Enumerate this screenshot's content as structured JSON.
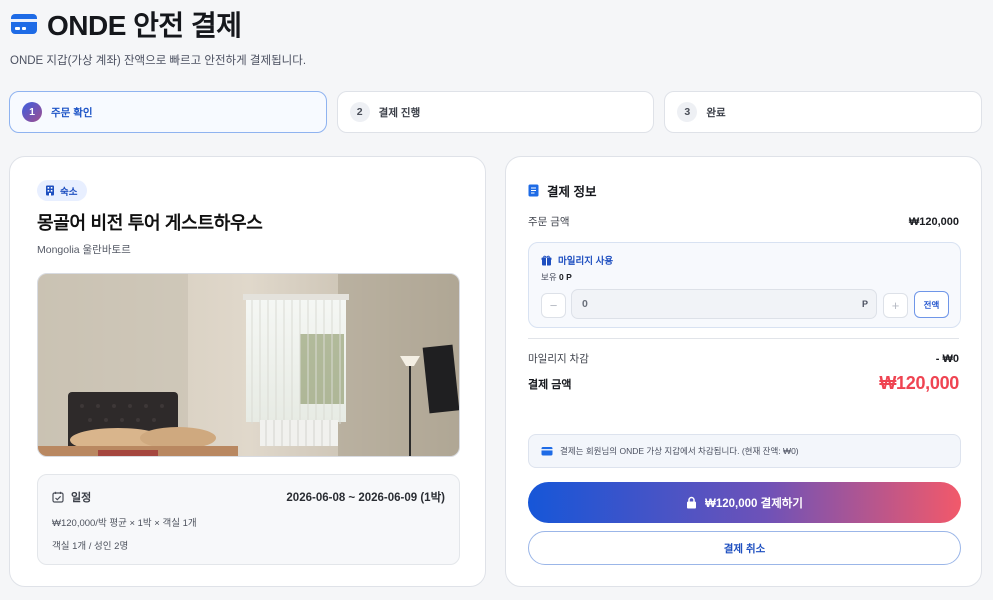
{
  "header": {
    "title": "ONDE 안전 결제",
    "subtitle": "ONDE 지갑(가상 계좌) 잔액으로 빠르고 안전하게 결제됩니다.",
    "icon": "credit-card-icon"
  },
  "steps": [
    {
      "num": "1",
      "label": "주문 확인",
      "active": true
    },
    {
      "num": "2",
      "label": "결제 진행",
      "active": false
    },
    {
      "num": "3",
      "label": "완료",
      "active": false
    }
  ],
  "stay": {
    "badge": "숙소",
    "badge_icon": "building-icon",
    "title": "몽골어 비전 투어 게스트하우스",
    "location": "Mongolia 울란바토르",
    "photo": "guestroom-photo",
    "schedule": {
      "label": "일정",
      "icon": "calendar-check-icon",
      "dates": "2026-06-08 ~ 2026-06-09 (1박)",
      "price_line": "₩120,000/박 평균 × 1박 × 객실 1개",
      "guest_line": "객실 1개 / 성인 2명"
    }
  },
  "payment": {
    "title": "결제 정보",
    "title_icon": "document-icon",
    "order_amount_label": "주문 금액",
    "order_amount": "₩120,000",
    "mileage": {
      "title": "마일리지 사용",
      "icon": "gift-icon",
      "hold_label": "보유",
      "hold_value": "0 P",
      "input_value": "0",
      "unit": "P",
      "minus": "−",
      "plus": "+",
      "all_label": "전액"
    },
    "deduction_label": "마일리지 차감",
    "deduction_value": "- ₩0",
    "total_label": "결제 금액",
    "total_value": "₩120,000",
    "notice": "결제는 회원님의 ONDE 가상 지갑에서 차감됩니다. (현재 잔액: ₩0)",
    "notice_icon": "wallet-icon",
    "pay_button": "₩120,000 결제하기",
    "pay_icon": "lock-icon",
    "cancel_button": "결제 취소"
  },
  "colors": {
    "accent": "#1e55c7",
    "total": "#ef4452",
    "gradient_start": "#1656d8",
    "gradient_end": "#f2596a"
  }
}
